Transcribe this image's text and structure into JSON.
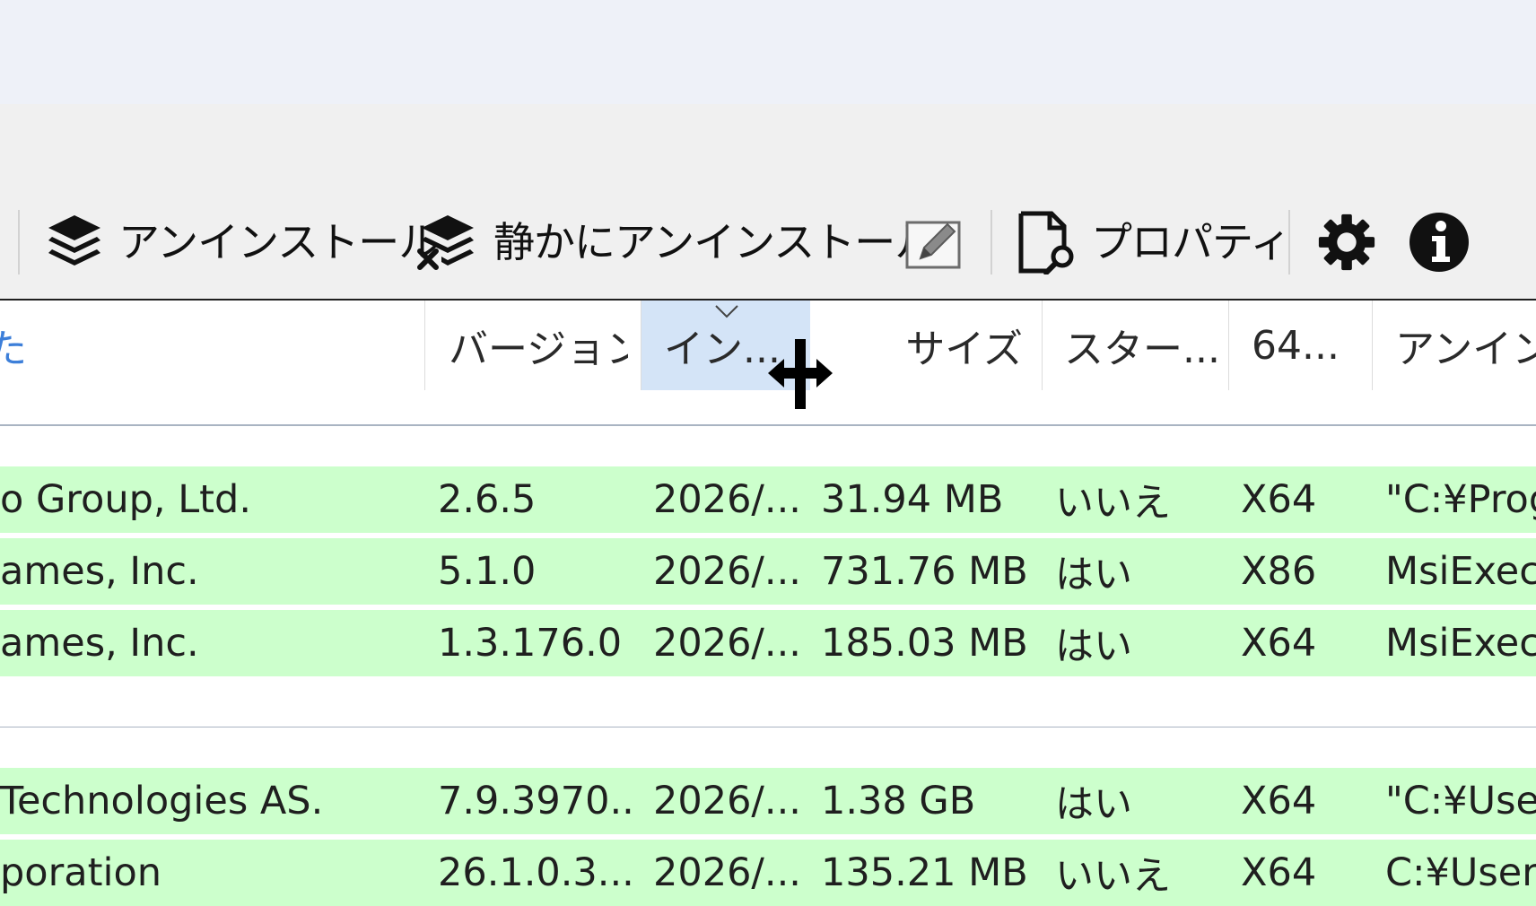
{
  "toolbar": {
    "uninstall_label": "アンインストール",
    "quiet_uninstall_label": "静かにアンインストール",
    "properties_label": "プロパティ",
    "icons": {
      "uninstall": "layers-icon",
      "quiet_uninstall": "layers-x-icon",
      "edit": "pencil-edit-icon",
      "properties": "document-search-icon",
      "settings": "gear-icon",
      "info": "info-icon"
    }
  },
  "columns": {
    "name_fragment": "た",
    "version": "バージョン",
    "install_date": "イン...",
    "size": "サイズ",
    "startup": "スター...",
    "bitness": "64...",
    "uninstall_cmd": "アンインス"
  },
  "groups": [
    {
      "rows": [
        {
          "publisher": "o Group, Ltd.",
          "version": "2.6.5",
          "date": "2026/...",
          "size": "31.94 MB",
          "startup": "いいえ",
          "bitness": "X64",
          "uninstall": "\"C:¥Prog"
        },
        {
          "publisher": "ames, Inc.",
          "version": "5.1.0",
          "date": "2026/...",
          "size": "731.76 MB",
          "startup": "はい",
          "bitness": "X86",
          "uninstall": "MsiExec"
        },
        {
          "publisher": "ames, Inc.",
          "version": "1.3.176.0",
          "date": "2026/...",
          "size": "185.03 MB",
          "startup": "はい",
          "bitness": "X64",
          "uninstall": "MsiExec"
        }
      ]
    },
    {
      "rows": [
        {
          "publisher": "Technologies AS.",
          "version": "7.9.3970...",
          "date": "2026/...",
          "size": "1.38 GB",
          "startup": "はい",
          "bitness": "X64",
          "uninstall": "\"C:¥User"
        },
        {
          "publisher": "poration",
          "version": "26.1.0.3...",
          "date": "2026/...",
          "size": "135.21 MB",
          "startup": "いいえ",
          "bitness": "X64",
          "uninstall": "C:¥Users"
        }
      ]
    }
  ],
  "colors": {
    "row_highlight": "#ccffcc",
    "header_selected": "#d4e4f7",
    "ribbon_bg": "#f0f0f0",
    "titlebar_bg": "#eef1f8"
  }
}
